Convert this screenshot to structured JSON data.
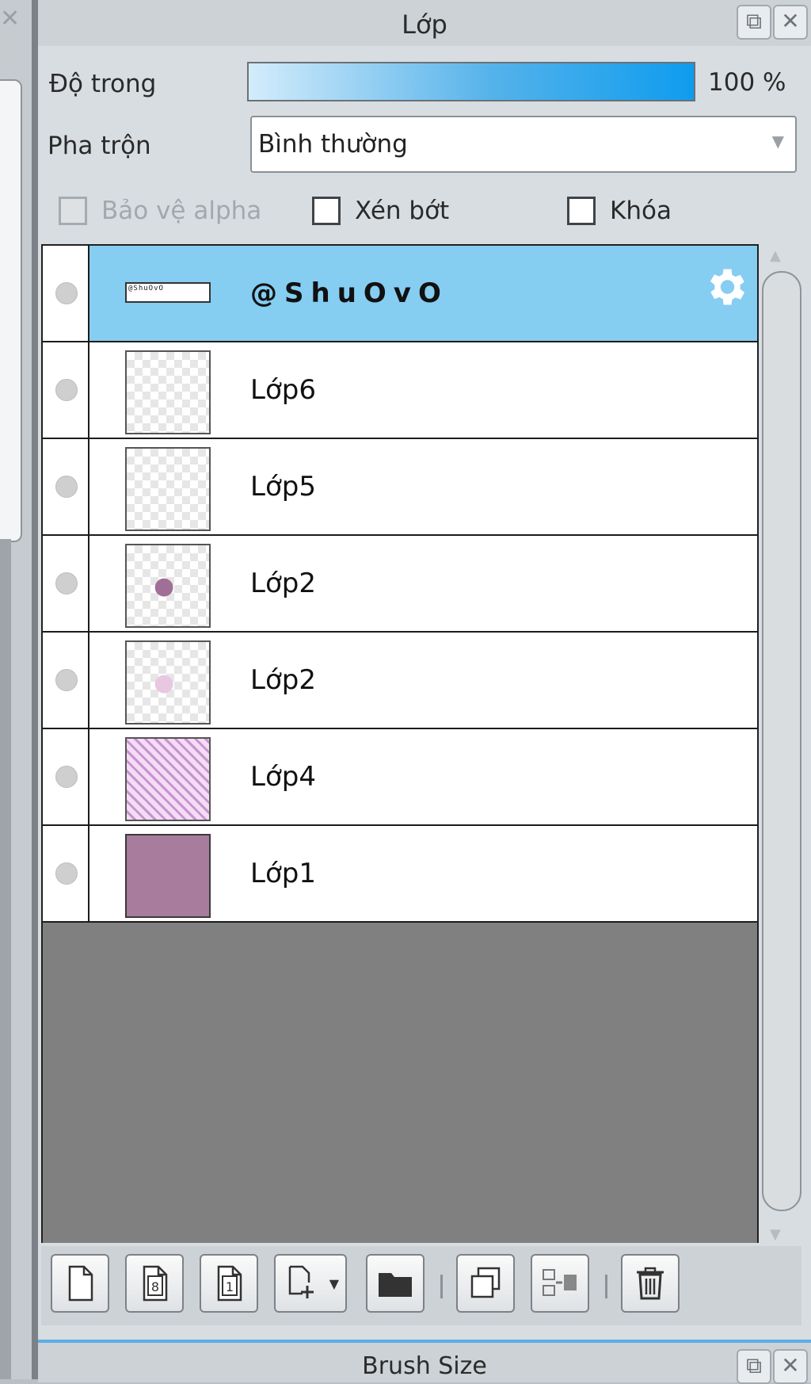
{
  "panel": {
    "title": "Lớp",
    "opacity_label": "Độ trong",
    "opacity_value": "100 %",
    "opacity_fraction": 1.0,
    "blend_label": "Pha trộn",
    "blend_value": "Bình thường",
    "checkboxes": [
      {
        "label": "Bảo vệ alpha",
        "enabled": false
      },
      {
        "label": "Xén bớt",
        "enabled": true
      },
      {
        "label": "Khóa",
        "enabled": true
      }
    ]
  },
  "layers": [
    {
      "name": "@ShuOvO",
      "selected": true,
      "thumb": "text",
      "thumb_text": "@ShuOvO"
    },
    {
      "name": "Lớp6",
      "thumb": "transparent"
    },
    {
      "name": "Lớp5",
      "thumb": "transparent"
    },
    {
      "name": "Lớp2",
      "thumb": "transparent-mark"
    },
    {
      "name": "Lớp2",
      "thumb": "transparent-faint"
    },
    {
      "name": "Lớp4",
      "thumb": "hatch"
    },
    {
      "name": "Lớp1",
      "thumb": "solid"
    }
  ],
  "toolbar": {
    "buttons": [
      "new-layer-icon",
      "new-8bit-layer-icon",
      "new-1bit-layer-icon",
      "add-layer-menu-icon",
      "new-folder-icon",
      "duplicate-layer-icon",
      "merge-down-icon",
      "delete-layer-icon"
    ],
    "tile_digits": [
      "8",
      "1"
    ]
  },
  "bottom_panel": {
    "title": "Brush Size"
  },
  "colors": {
    "selected_row": "#86cdf2",
    "opacity_bar": "#0f9cee",
    "bottom_accent": "#59aee6"
  }
}
